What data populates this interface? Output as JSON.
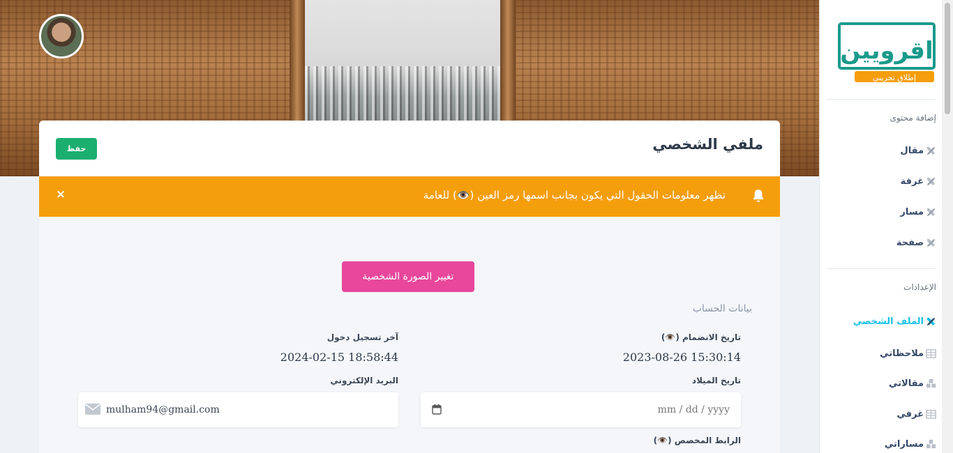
{
  "header": {
    "title": "ملفي الشخصي",
    "save_label": "حفظ"
  },
  "alert": {
    "text": "تظهر معلومات الحقول التي يكون بجانب اسمها رمز العين (👁️) للعامة",
    "close": "×"
  },
  "profile": {
    "change_photo_label": "تغيير الصورة الشخصية",
    "section_title": "بيانات الحساب",
    "join_date_label": "تاريخ الانضمام (👁️)",
    "join_date_value": "2023-08-26 15:30:14",
    "last_login_label": "آخر تسجيل دخول",
    "last_login_value": "2024-02-15 18:58:44",
    "birthdate_label": "تاريخ الميلاد",
    "birthdate_placeholder": "mm / dd / yyyy",
    "email_label": "البريد الإلكتروني",
    "email_value": "mulham94@gmail.com",
    "custom_link_label": "الرابط المخصص (👁️)"
  },
  "sidebar": {
    "add_content_heading": "إضافة محتوى",
    "add_items": [
      {
        "label": "مقال"
      },
      {
        "label": "غرفة"
      },
      {
        "label": "مسار"
      },
      {
        "label": "صفحة"
      }
    ],
    "settings_heading": "الإعدادات",
    "settings_items": [
      {
        "label": "الملف الشخصي",
        "active": true
      },
      {
        "label": "ملاحظاتي"
      },
      {
        "label": "مقالاتي"
      },
      {
        "label": "غرفي"
      },
      {
        "label": "مساراتي"
      }
    ],
    "logo_text": "اقرويين",
    "logo_tagline": "إطلاق تجريبي"
  },
  "colors": {
    "save": "#1aae6f",
    "alert": "#f59e0b",
    "change_photo": "#e8479b",
    "active_nav": "#17c1e8",
    "logo": "#1a9a8c"
  }
}
